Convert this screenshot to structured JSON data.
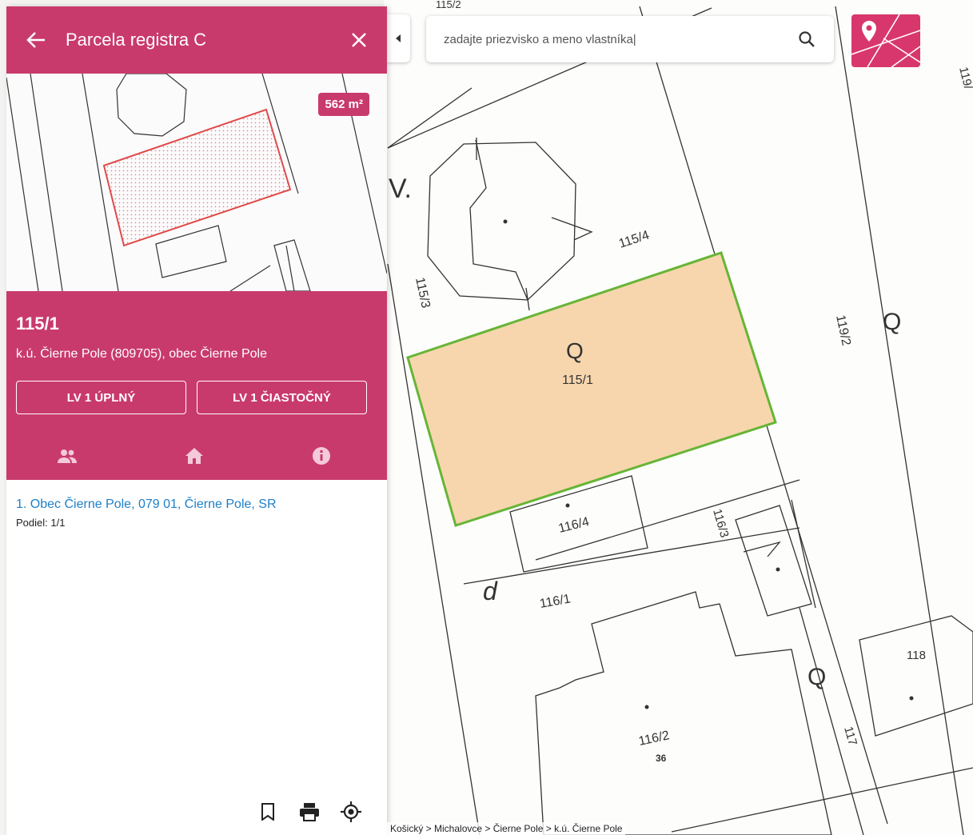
{
  "map": {
    "labels": {
      "top_partial": "115/2",
      "lv": "V.",
      "p115_3": "115/3",
      "p115_4": "115/4",
      "p115_1_letter": "Q",
      "p115_1": "115/1",
      "p119_2": "119/2",
      "p119_2_letter": "Q",
      "p116_4": "116/4",
      "p116_3": "116/3",
      "p116_1_letter": "d",
      "p116_1": "116/1",
      "p116_2": "116/2",
      "p116_2_house": "36",
      "p117": "117",
      "p118": "118",
      "p117_letter": "Q",
      "edge_right": "119/"
    },
    "colors": {
      "selected_fill": "#f7d6ad",
      "selected_border": "#66b536",
      "line": "#333333"
    }
  },
  "search": {
    "placeholder": "zadajte priezvisko a meno vlastníka|",
    "value": "",
    "icon": "search-icon"
  },
  "panel": {
    "title": "Parcela registra C",
    "back_icon": "arrow-left-icon",
    "close_icon": "close-icon",
    "area_badge": "562 m²",
    "parcel_number": "115/1",
    "location": "k.ú. Čierne Pole (809705), obec Čierne Pole",
    "buttons": {
      "lv_full": "LV 1 ÚPLNÝ",
      "lv_partial": "LV 1 ČIASTOČNÝ"
    },
    "tabs": [
      {
        "icon": "people-icon",
        "active": true
      },
      {
        "icon": "home-icon",
        "active": false
      },
      {
        "icon": "info-icon",
        "active": false
      }
    ],
    "owner": {
      "name": "1. Obec Čierne Pole, 079 01, Čierne Pole, SR",
      "share": "Podiel: 1/1"
    },
    "actions": [
      "bookmark-icon",
      "print-icon",
      "locate-icon"
    ]
  },
  "breadcrumb": "Košický > Michalovce > Čierne Pole > k.ú. Čierne Pole",
  "brand": {
    "accent": "#c93a6c"
  }
}
